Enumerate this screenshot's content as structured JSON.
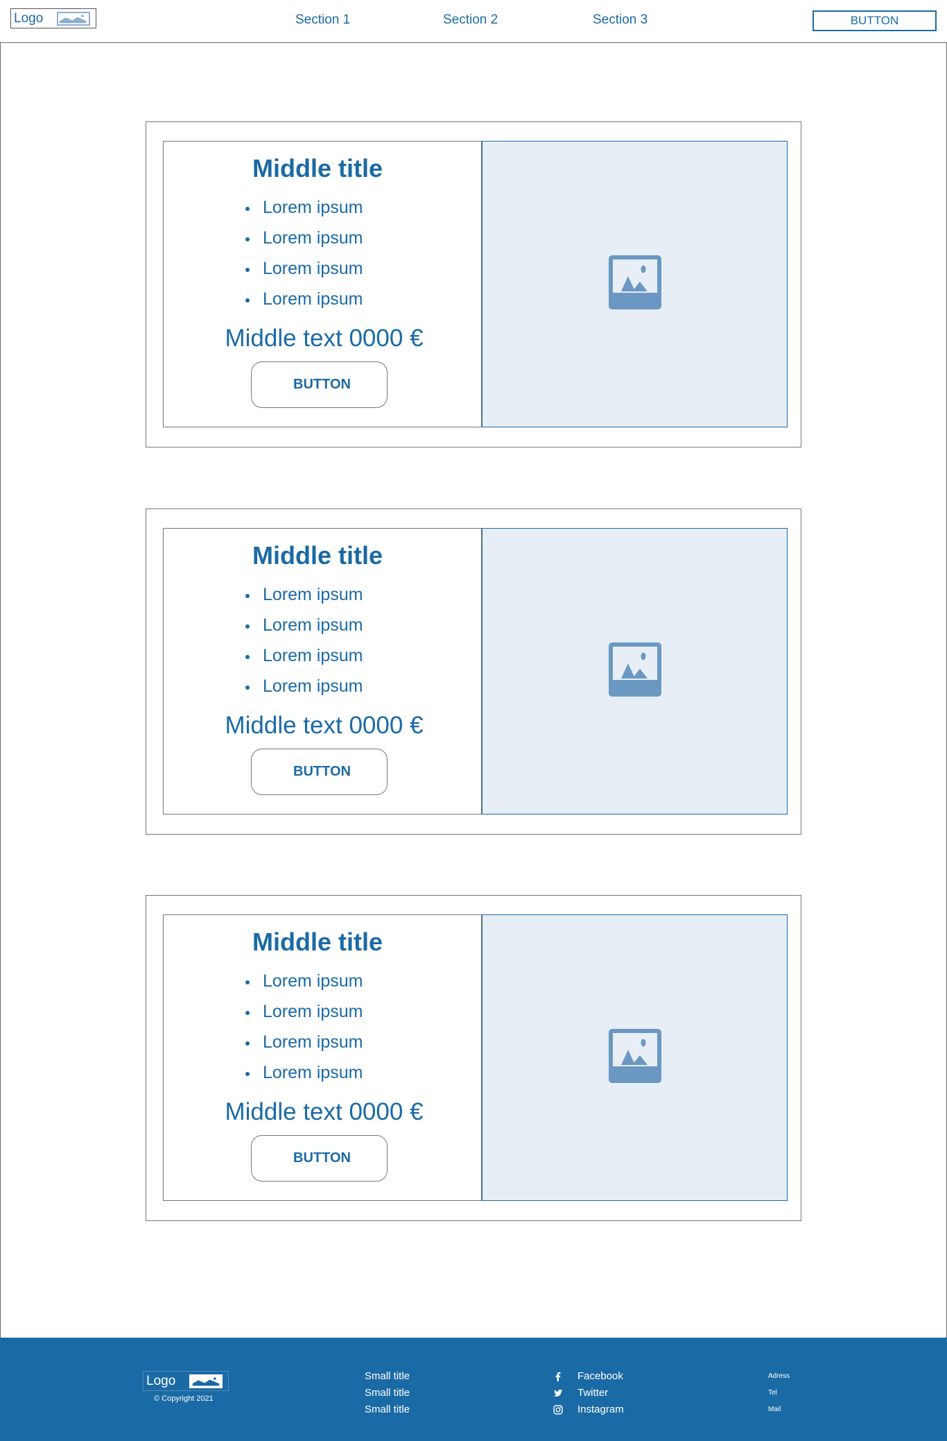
{
  "header": {
    "logo_label": "Logo",
    "nav": [
      "Section 1",
      "Section 2",
      "Section 3"
    ],
    "button_label": "BUTTON"
  },
  "cards": [
    {
      "title": "Middle title",
      "items": [
        "Lorem ipsum",
        "Lorem ipsum",
        "Lorem ipsum",
        "Lorem ipsum"
      ],
      "price": "Middle text 0000 €",
      "button_label": "BUTTON",
      "image_icon": "image-placeholder-icon"
    },
    {
      "title": "Middle title",
      "items": [
        "Lorem ipsum",
        "Lorem ipsum",
        "Lorem ipsum",
        "Lorem ipsum"
      ],
      "price": "Middle text 0000 €",
      "button_label": "BUTTON",
      "image_icon": "image-placeholder-icon"
    },
    {
      "title": "Middle title",
      "items": [
        "Lorem ipsum",
        "Lorem ipsum",
        "Lorem ipsum",
        "Lorem ipsum"
      ],
      "price": "Middle text 0000 €",
      "button_label": "BUTTON",
      "image_icon": "image-placeholder-icon"
    }
  ],
  "footer": {
    "logo_label": "Logo",
    "copyright": "© Copyright 2021",
    "links": [
      "Small title",
      "Small title",
      "Small title"
    ],
    "social": [
      {
        "icon": "facebook-icon",
        "label": "Facebook"
      },
      {
        "icon": "twitter-icon",
        "label": "Twitter"
      },
      {
        "icon": "instagram-icon",
        "label": "Instagram"
      }
    ],
    "contact": [
      "Adress",
      "Tel",
      "Mail"
    ]
  },
  "colors": {
    "accent": "#1a6aa5",
    "image_bg": "#e8eef6",
    "placeholder_icon": "#6a98c2"
  }
}
